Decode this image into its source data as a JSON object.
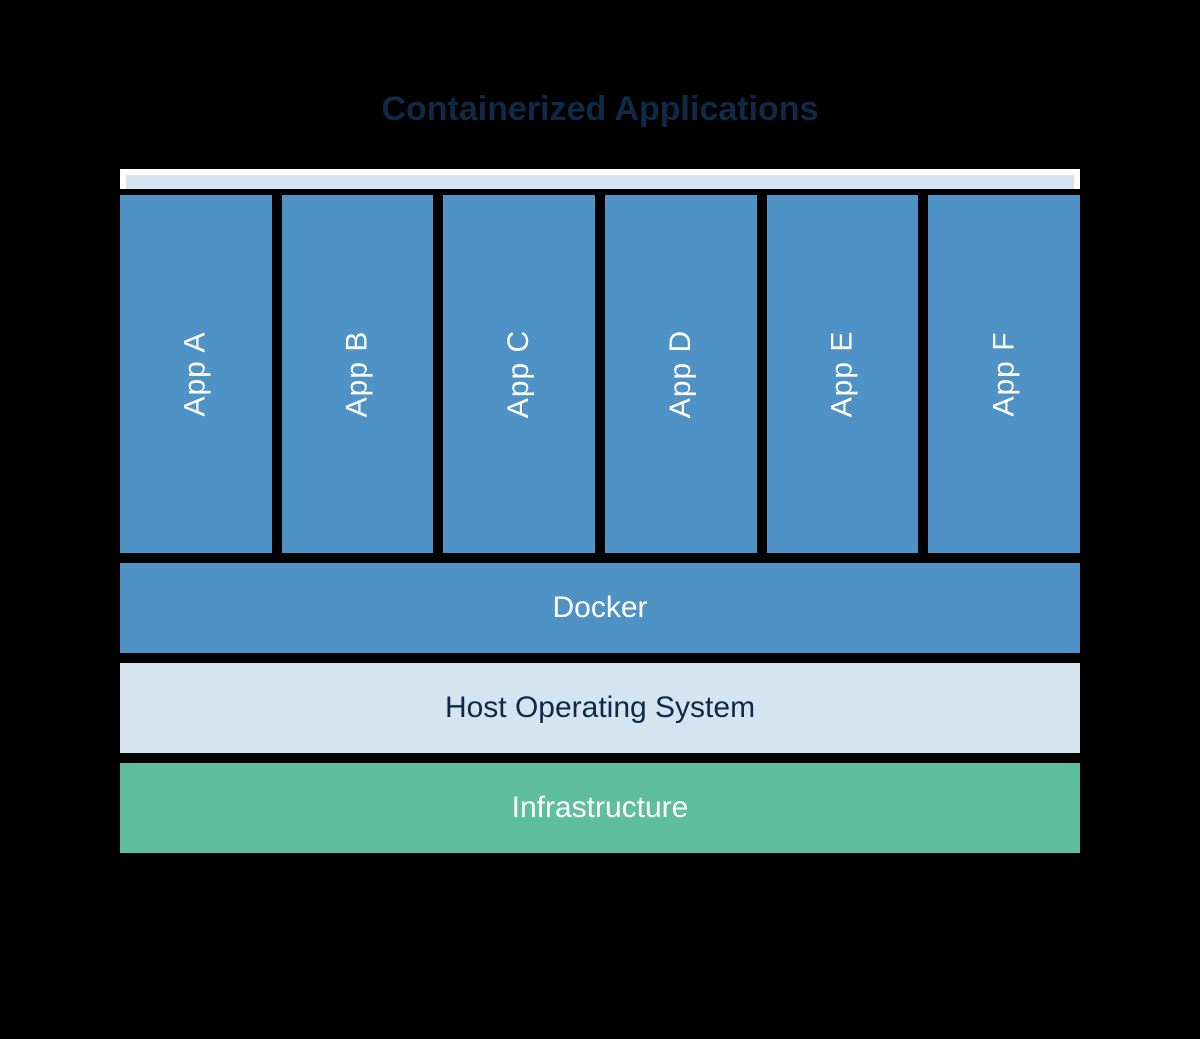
{
  "title": "Containerized Applications",
  "apps": [
    {
      "label": "App A"
    },
    {
      "label": "App B"
    },
    {
      "label": "App C"
    },
    {
      "label": "App D"
    },
    {
      "label": "App E"
    },
    {
      "label": "App F"
    }
  ],
  "layers": {
    "docker": "Docker",
    "host_os": "Host Operating System",
    "infrastructure": "Infrastructure"
  },
  "colors": {
    "app_bg": "#4f93c6",
    "docker_bg": "#4f93c6",
    "host_os_bg": "#d4e4f0",
    "infra_bg": "#5fbe9e",
    "title_color": "#0e2a47"
  }
}
